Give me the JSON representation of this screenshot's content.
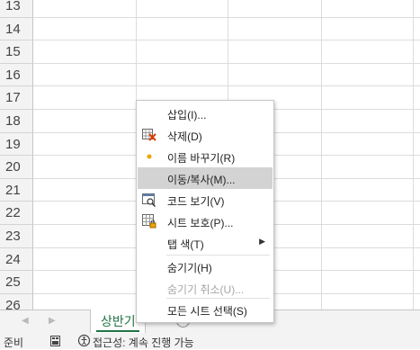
{
  "grid": {
    "row_numbers": [
      "13",
      "14",
      "15",
      "16",
      "17",
      "18",
      "19",
      "20",
      "21",
      "22",
      "23",
      "24",
      "25",
      "26"
    ]
  },
  "context_menu": {
    "insert": "삽입(I)...",
    "delete": "삭제(D)",
    "rename": "이름 바꾸기(R)",
    "move_copy": "이동/복사(M)...",
    "view_code": "코드 보기(V)",
    "protect_sheet": "시트 보호(P)...",
    "tab_color": "탭 색(T)",
    "hide": "숨기기(H)",
    "unhide": "숨기기 취소(U)...",
    "select_all_sheets": "모든 시트 선택(S)"
  },
  "sheet_tab": {
    "label": "상반기"
  },
  "statusbar": {
    "ready": "준비",
    "accessibility": "접근성: 계속 진행 가능"
  },
  "colors": {
    "accent": "#217346",
    "highlight": "#d3d3d3",
    "rename_dot": "#f0a30a",
    "delete_x": "#d83b01"
  }
}
